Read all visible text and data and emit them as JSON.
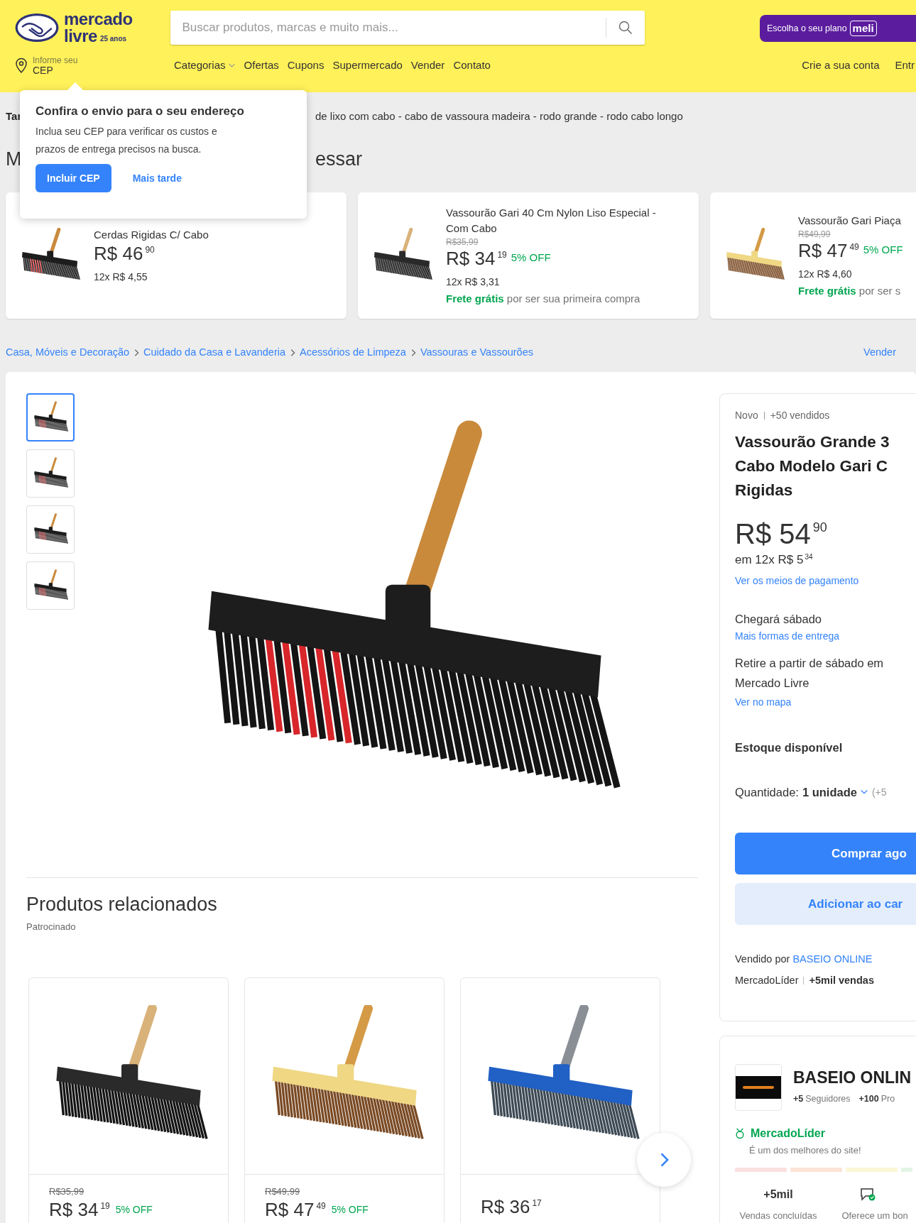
{
  "header": {
    "logo": {
      "word1": "mercado",
      "word2": "livre",
      "badge": "25 anos"
    },
    "search": {
      "placeholder": "Buscar produtos, marcas e muito mais..."
    },
    "plan_button": {
      "label": "Escolha o seu plano",
      "brand": "meli"
    },
    "location": {
      "line1": "Informe seu",
      "line2": "CEP"
    },
    "nav": [
      {
        "label": "Categorias",
        "dropdown": true
      },
      {
        "label": "Ofertas",
        "dropdown": false
      },
      {
        "label": "Cupons",
        "dropdown": false
      },
      {
        "label": "Supermercado",
        "dropdown": false
      },
      {
        "label": "Vender",
        "dropdown": false
      },
      {
        "label": "Contato",
        "dropdown": false
      }
    ],
    "account_links": [
      "Crie a sua conta",
      "Entr"
    ]
  },
  "cep_popup": {
    "title": "Confira o envio para o seu endereço",
    "body": "Inclua seu CEP para verificar os custos e prazos de entrega precisos na busca.",
    "primary_button": "Incluir CEP",
    "secondary_link": "Mais tarde"
  },
  "trends": {
    "label": "Tar",
    "text": "de lixo com cabo - cabo de vassoura madeira - rodo grande - rodo cabo longo"
  },
  "recommendations": {
    "title_start": "M",
    "title_end": "essar",
    "cards": [
      {
        "kind": "red-black",
        "title": "Cerdas Rigidas C/ Cabo",
        "price": "R$ 46",
        "cents": "90",
        "installments": "12x R$ 4,55"
      },
      {
        "kind": "black",
        "title": "Vassourão Gari 40 Cm Nylon Liso Especial - Com Cabo",
        "old_price": "R$35,99",
        "price": "R$ 34",
        "cents": "19",
        "discount": "5% OFF",
        "installments": "12x R$ 3,31",
        "shipping": "**Frete grátis** por ser sua primeira compra"
      },
      {
        "kind": "piassava",
        "title": "Vassourão Gari Piaça",
        "old_price": "R$49,99",
        "price": "R$ 47",
        "cents": "49",
        "discount": "5% OFF",
        "installments": "12x R$ 4,60",
        "shipping": "**Frete grátis** por ser s"
      }
    ]
  },
  "breadcrumb": {
    "items": [
      "Casa, Móveis e Decoração",
      "Cuidado da Casa e Lavanderia",
      "Acessórios de Limpeza",
      "Vassouras e Vassourões"
    ],
    "sell_link": "Vender"
  },
  "gallery": {
    "kind": "red-black",
    "thumbnails": [
      {
        "selected": true
      },
      {
        "selected": false
      },
      {
        "selected": false
      },
      {
        "selected": false
      }
    ]
  },
  "related": {
    "title": "Produtos relacionados",
    "sponsored": "Patrocinado",
    "cards": [
      {
        "kind": "black",
        "old_price": "R$35,99",
        "price": "R$ 34",
        "cents": "19",
        "discount": "5% OFF"
      },
      {
        "kind": "piassava",
        "old_price": "R$49,99",
        "price": "R$ 47",
        "cents": "49",
        "discount": "5% OFF"
      },
      {
        "kind": "blue",
        "price": "R$ 36",
        "cents": "17"
      }
    ]
  },
  "buy_box": {
    "condition": "Novo",
    "sold": "+50 vendidos",
    "title_lines": [
      "Vassourão Grande 3",
      "Cabo Modelo Gari C",
      "Rigidas"
    ],
    "price": "R$ 54",
    "cents": "90",
    "installments": "em 12x R$ 5",
    "installment_cents": "34",
    "payment_link": "Ver os meios de pagamento",
    "delivery": "Chegará sábado",
    "delivery_link": "Mais formas de entrega",
    "pickup": "Retire a partir de sábado em Mercado Livre",
    "map_link": "Ver no mapa",
    "stock": "Estoque disponível",
    "quantity_label": "Quantidade:",
    "quantity_value": "1 unidade",
    "quantity_extra": "(+5",
    "buy_button": "Comprar ago",
    "cart_button": "Adicionar ao car",
    "sold_by": "Vendido por",
    "seller_link": "BASEIO ONLINE",
    "leader": "MercadoLíder",
    "leader_sales": "+5mil vendas"
  },
  "seller": {
    "name": "BASEIO ONLIN",
    "followers_count": "+5",
    "followers_label": "Seguidores",
    "products_count": "+100",
    "products_label": "Pro",
    "badge": "MercadoLíder",
    "badge_text": "É um dos melhores do site!",
    "sales_count": "+5mil",
    "sales_label": "Vendas concluídas",
    "service_label": "Oferece um bon"
  }
}
